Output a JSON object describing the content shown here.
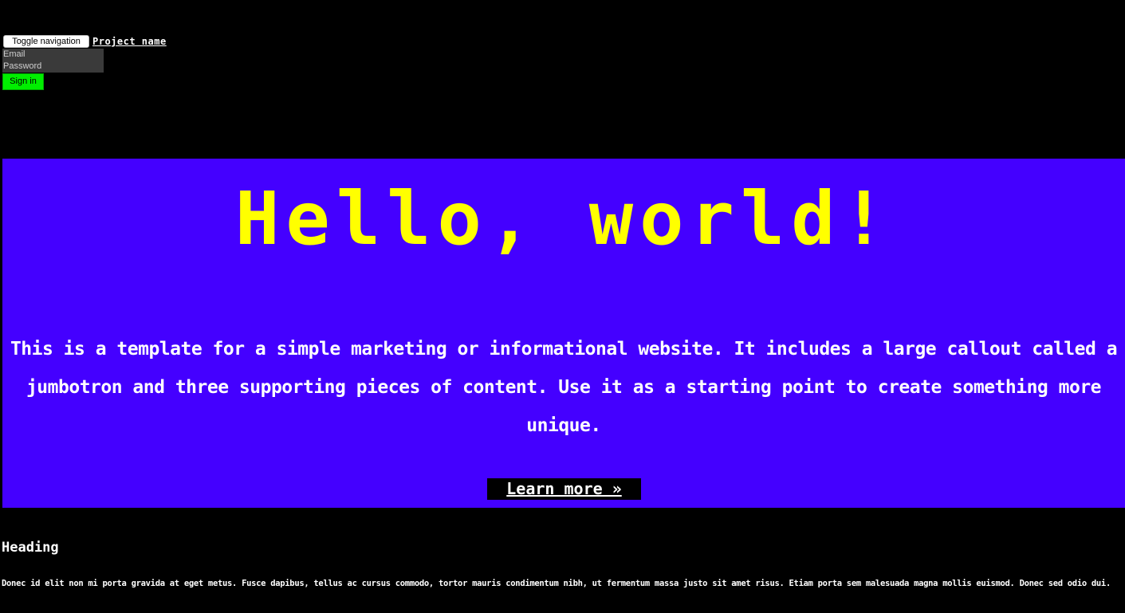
{
  "navbar": {
    "toggle_label": "Toggle navigation",
    "brand": "Project name",
    "email_placeholder": "Email",
    "password_placeholder": "Password",
    "signin_label": "Sign in"
  },
  "jumbotron": {
    "title": "Hello, world!",
    "text": "This is a template for a simple marketing or informational website. It includes a large callout called a jumbotron and three supporting pieces of content. Use it as a starting point to create something more unique.",
    "button_label": "Learn more »"
  },
  "columns": [
    {
      "heading": "Heading",
      "text": "Donec id elit non mi porta gravida at eget metus. Fusce dapibus, tellus ac cursus commodo, tortor mauris condimentum nibh, ut fermentum massa justo sit amet risus. Etiam porta sem malesuada magna mollis euismod. Donec sed odio dui."
    }
  ],
  "colors": {
    "background": "#000000",
    "jumbotron_bg": "#4400ff",
    "title": "#ffff00",
    "signin_button": "#00ee00",
    "text": "#ffffff"
  }
}
